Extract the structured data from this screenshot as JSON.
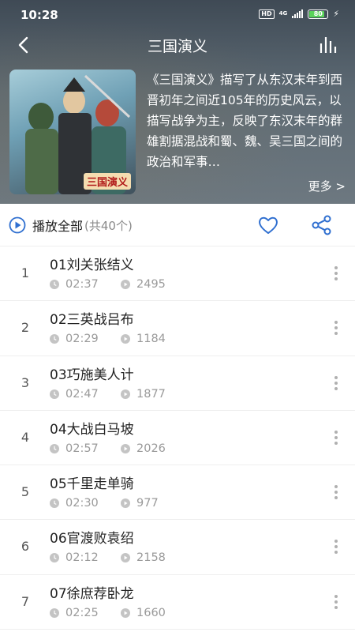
{
  "status": {
    "time": "10:28",
    "hd": "HD",
    "network": "4G",
    "battery": "80"
  },
  "nav": {
    "title": "三国演义",
    "back_icon": "back-arrow-icon",
    "bars_icon": "equalizer-icon"
  },
  "album": {
    "cover_label": "三国演义",
    "description": "《三国演义》描写了从东汉末年到西晋初年之间近105年的历史风云，以描写战争为主，反映了东汉末年的群雄割据混战和蜀、魏、吴三国之间的政治和军事…",
    "more_label": "更多 >"
  },
  "actions": {
    "play_all_label": "播放全部",
    "count_label": "(共40个)"
  },
  "colors": {
    "accent": "#2f6fd0",
    "meta_icon": "#b8b8b8"
  },
  "tracks": [
    {
      "index": "1",
      "title": "01刘关张结义",
      "duration": "02:37",
      "plays": "2495"
    },
    {
      "index": "2",
      "title": "02三英战吕布",
      "duration": "02:29",
      "plays": "1184"
    },
    {
      "index": "3",
      "title": "03巧施美人计",
      "duration": "02:47",
      "plays": "1877"
    },
    {
      "index": "4",
      "title": "04大战白马坡",
      "duration": "02:57",
      "plays": "2026"
    },
    {
      "index": "5",
      "title": "05千里走单骑",
      "duration": "02:30",
      "plays": "977"
    },
    {
      "index": "6",
      "title": "06官渡败袁绍",
      "duration": "02:12",
      "plays": "2158"
    },
    {
      "index": "7",
      "title": "07徐庶荐卧龙",
      "duration": "02:25",
      "plays": "1660"
    }
  ]
}
